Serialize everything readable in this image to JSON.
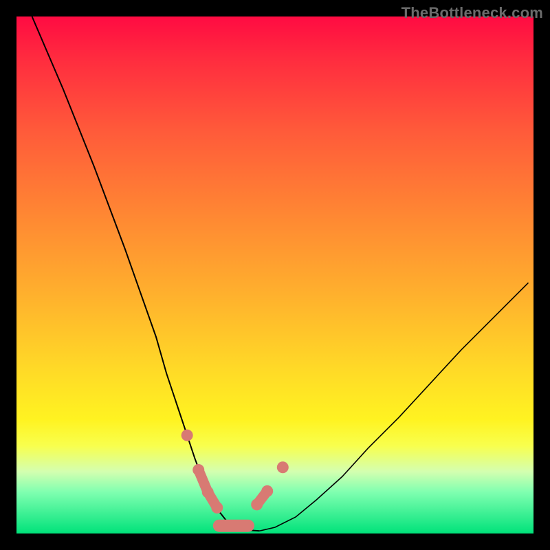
{
  "watermark": "TheBottleneck.com",
  "colors": {
    "frame_bg_top": "#ff0b42",
    "frame_bg_bottom": "#00e27a",
    "curve": "#000000",
    "marker": "#d87a73",
    "page_bg": "#000000",
    "watermark": "#6b6b6b"
  },
  "chart_data": {
    "type": "line",
    "title": "",
    "xlabel": "",
    "ylabel": "",
    "xlim": [
      0,
      100
    ],
    "ylim": [
      0,
      100
    ],
    "series": [
      {
        "name": "bottleneck-curve",
        "x": [
          3,
          6,
          9,
          12,
          15,
          18,
          21,
          24,
          27,
          29,
          31,
          33,
          34.5,
          36,
          37.5,
          39,
          40.5,
          42,
          44,
          47,
          50,
          54,
          58,
          63,
          68,
          74,
          80,
          86,
          92,
          99
        ],
        "y": [
          100,
          93,
          86,
          78.5,
          71,
          63,
          55,
          46.5,
          38,
          31,
          25,
          19,
          14.5,
          10.5,
          7,
          4.5,
          2.6,
          1.4,
          0.7,
          0.5,
          1.2,
          3.2,
          6.5,
          11,
          16.5,
          22.5,
          29,
          35.5,
          41.5,
          48.5
        ]
      }
    ],
    "markers": {
      "name": "highlighted-points",
      "points": [
        {
          "x": 33.0,
          "y": 19.0
        },
        {
          "x": 35.2,
          "y": 12.3
        },
        {
          "x": 37.0,
          "y": 8.0
        },
        {
          "x": 38.8,
          "y": 5.0
        },
        {
          "x": 46.5,
          "y": 5.6
        },
        {
          "x": 48.5,
          "y": 8.2
        },
        {
          "x": 51.5,
          "y": 12.8
        }
      ],
      "capsules": [
        {
          "x1": 35.2,
          "y1": 12.3,
          "x2": 37.0,
          "y2": 8.0
        },
        {
          "x1": 37.0,
          "y1": 8.0,
          "x2": 38.8,
          "y2": 5.0
        },
        {
          "x1": 46.5,
          "y1": 5.6,
          "x2": 48.5,
          "y2": 8.2
        }
      ],
      "floor_band": {
        "x1": 38.0,
        "x2": 46.0,
        "y": 1.5,
        "thickness": 2.4
      }
    },
    "background_gradient": [
      {
        "stop": 0.0,
        "color": "#ff0b42"
      },
      {
        "stop": 0.5,
        "color": "#ffb12d"
      },
      {
        "stop": 0.78,
        "color": "#fff321"
      },
      {
        "stop": 1.0,
        "color": "#00e27a"
      }
    ]
  }
}
